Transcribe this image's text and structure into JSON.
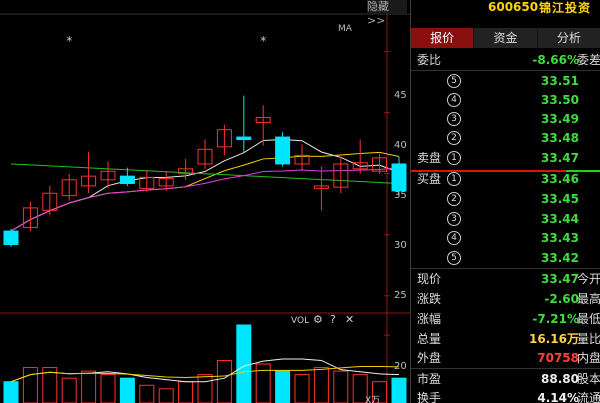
{
  "chart": {
    "hide_label": "隐藏",
    "hide_chevron": ">>",
    "ma_label": "MA",
    "vol_label": "VOL",
    "vol_unit": "X万",
    "price_ticks": [
      "45",
      "40",
      "35",
      "30",
      "25"
    ],
    "vol_ticks": [
      "20"
    ],
    "icons": {
      "settings": "gear-icon",
      "help": "question-icon",
      "close": "close-icon"
    }
  },
  "chart_data": {
    "type": "candlestick",
    "ylim": [
      24,
      48
    ],
    "candles": [
      {
        "o": 29.2,
        "c": 30.3,
        "h": 30.5,
        "l": 29.0,
        "up": false
      },
      {
        "o": 30.6,
        "c": 32.2,
        "h": 32.7,
        "l": 30.3,
        "up": true
      },
      {
        "o": 32.0,
        "c": 33.4,
        "h": 34.0,
        "l": 31.6,
        "up": true
      },
      {
        "o": 33.2,
        "c": 34.5,
        "h": 35.0,
        "l": 32.8,
        "up": true
      },
      {
        "o": 34.0,
        "c": 34.8,
        "h": 36.8,
        "l": 33.4,
        "up": true
      },
      {
        "o": 34.5,
        "c": 35.2,
        "h": 36.0,
        "l": 33.8,
        "up": true
      },
      {
        "o": 34.8,
        "c": 34.2,
        "h": 35.5,
        "l": 34.0,
        "up": false
      },
      {
        "o": 33.8,
        "c": 34.7,
        "h": 35.3,
        "l": 33.5,
        "up": true
      },
      {
        "o": 34.0,
        "c": 34.6,
        "h": 35.2,
        "l": 33.6,
        "up": true
      },
      {
        "o": 35.0,
        "c": 35.4,
        "h": 36.2,
        "l": 34.5,
        "up": true
      },
      {
        "o": 35.8,
        "c": 37.0,
        "h": 37.8,
        "l": 35.4,
        "up": true
      },
      {
        "o": 37.2,
        "c": 38.6,
        "h": 39.0,
        "l": 36.5,
        "up": true
      },
      {
        "o": 37.8,
        "c": 38.0,
        "h": 41.4,
        "l": 36.8,
        "up": false
      },
      {
        "o": 39.2,
        "c": 39.6,
        "h": 40.6,
        "l": 37.3,
        "up": true
      },
      {
        "o": 38.0,
        "c": 35.8,
        "h": 38.4,
        "l": 35.6,
        "up": false
      },
      {
        "o": 35.8,
        "c": 36.5,
        "h": 37.4,
        "l": 35.3,
        "up": true
      },
      {
        "o": 33.8,
        "c": 34.0,
        "h": 35.6,
        "l": 32.0,
        "up": true
      },
      {
        "o": 33.9,
        "c": 35.8,
        "h": 36.4,
        "l": 33.4,
        "up": true
      },
      {
        "o": 35.4,
        "c": 35.9,
        "h": 37.8,
        "l": 35.0,
        "up": true
      },
      {
        "o": 35.2,
        "c": 36.3,
        "h": 36.6,
        "l": 35.0,
        "up": true
      },
      {
        "o": 35.8,
        "c": 33.6,
        "h": 36.4,
        "l": 33.2,
        "up": false
      }
    ],
    "volumes": [
      6,
      10,
      10,
      7,
      9,
      8,
      7,
      5,
      4,
      6,
      8,
      12,
      22,
      11,
      9,
      8,
      10,
      9,
      8,
      6,
      7
    ],
    "vol_ylim": [
      0,
      22
    ],
    "star_markers": [
      {
        "index": 3
      },
      {
        "index": 13
      }
    ]
  },
  "panel": {
    "code": "600650",
    "name": "锦江投资",
    "tabs": [
      {
        "label": "报价",
        "active": true
      },
      {
        "label": "资金",
        "active": false
      },
      {
        "label": "分析",
        "active": false
      }
    ],
    "weibi": {
      "label": "委比",
      "value": "-8.66%",
      "tag": "委差"
    },
    "asks": [
      {
        "lvl": "5",
        "price": "33.51"
      },
      {
        "lvl": "4",
        "price": "33.50"
      },
      {
        "lvl": "3",
        "price": "33.49"
      },
      {
        "lvl": "2",
        "price": "33.48"
      },
      {
        "lvl": "1",
        "price": "33.47",
        "label": "卖盘"
      }
    ],
    "bids": [
      {
        "lvl": "1",
        "price": "33.46",
        "label": "买盘"
      },
      {
        "lvl": "2",
        "price": "33.45"
      },
      {
        "lvl": "3",
        "price": "33.44"
      },
      {
        "lvl": "4",
        "price": "33.43"
      },
      {
        "lvl": "5",
        "price": "33.42"
      }
    ],
    "stats": [
      {
        "label": "现价",
        "value": "33.47",
        "tag": "今开",
        "color": "green"
      },
      {
        "label": "涨跌",
        "value": "-2.60",
        "tag": "最高",
        "color": "green"
      },
      {
        "label": "涨幅",
        "value": "-7.21%",
        "tag": "最低",
        "color": "green"
      },
      {
        "label": "总量",
        "value": "16.16万",
        "tag": "量比",
        "color": "yellow"
      },
      {
        "label": "外盘",
        "value": "70758",
        "tag": "内盘",
        "color": "red"
      },
      {
        "label": "市盈",
        "value": "88.80",
        "tag": "股本",
        "color": "white"
      },
      {
        "label": "换手",
        "value": "4.14%",
        "tag": "流通",
        "color": "white"
      }
    ],
    "colors": {
      "up": "#ff3030",
      "down": "#00e5ff",
      "tab_active": "#8a1010"
    }
  }
}
